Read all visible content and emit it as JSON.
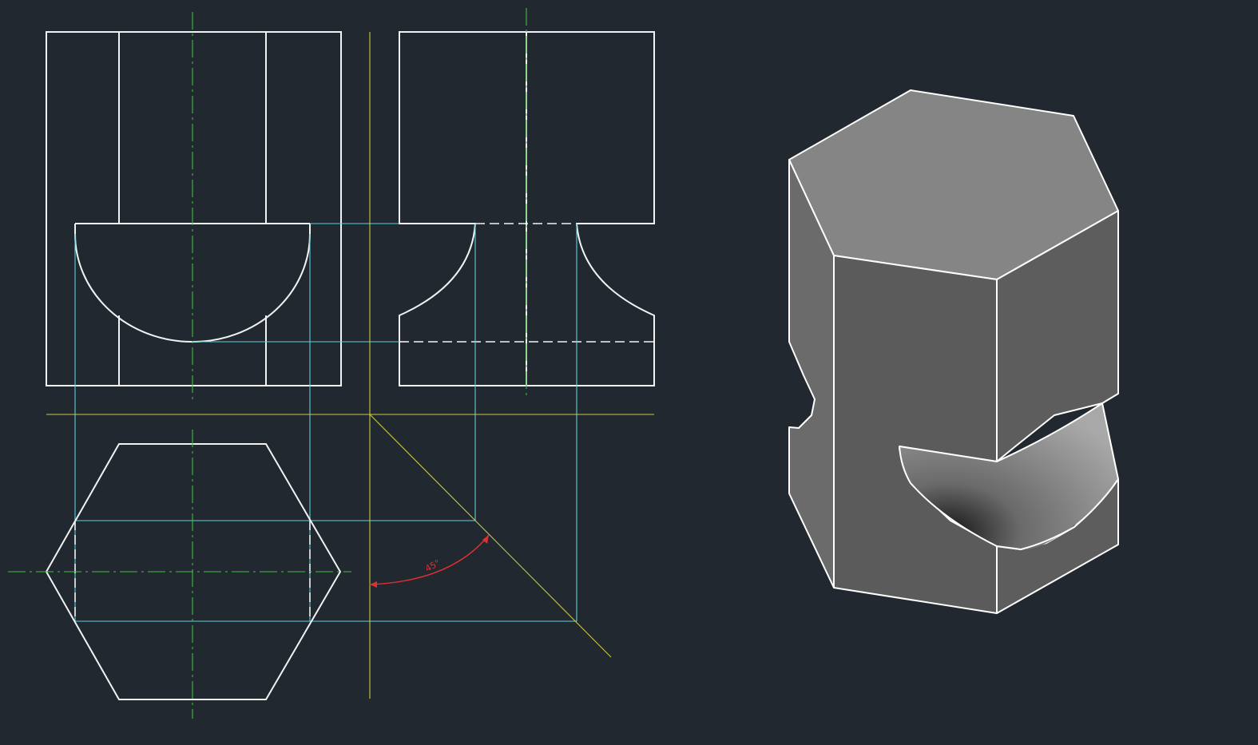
{
  "drawing": {
    "angle_dimension": "45°"
  },
  "colors": {
    "background": "#212830",
    "object_line": "#f2f2f2",
    "projection_line": "#5fd0dc",
    "center_line": "#3fbf3f",
    "construction_line": "#c8c840",
    "dimension": "#e03030",
    "iso_top_face": "#858585",
    "iso_front_face": "#5b5b5b",
    "iso_right_face": "#5d5d5d",
    "iso_left_face": "#6b6b6b",
    "iso_groove": "#a0a0a0"
  }
}
